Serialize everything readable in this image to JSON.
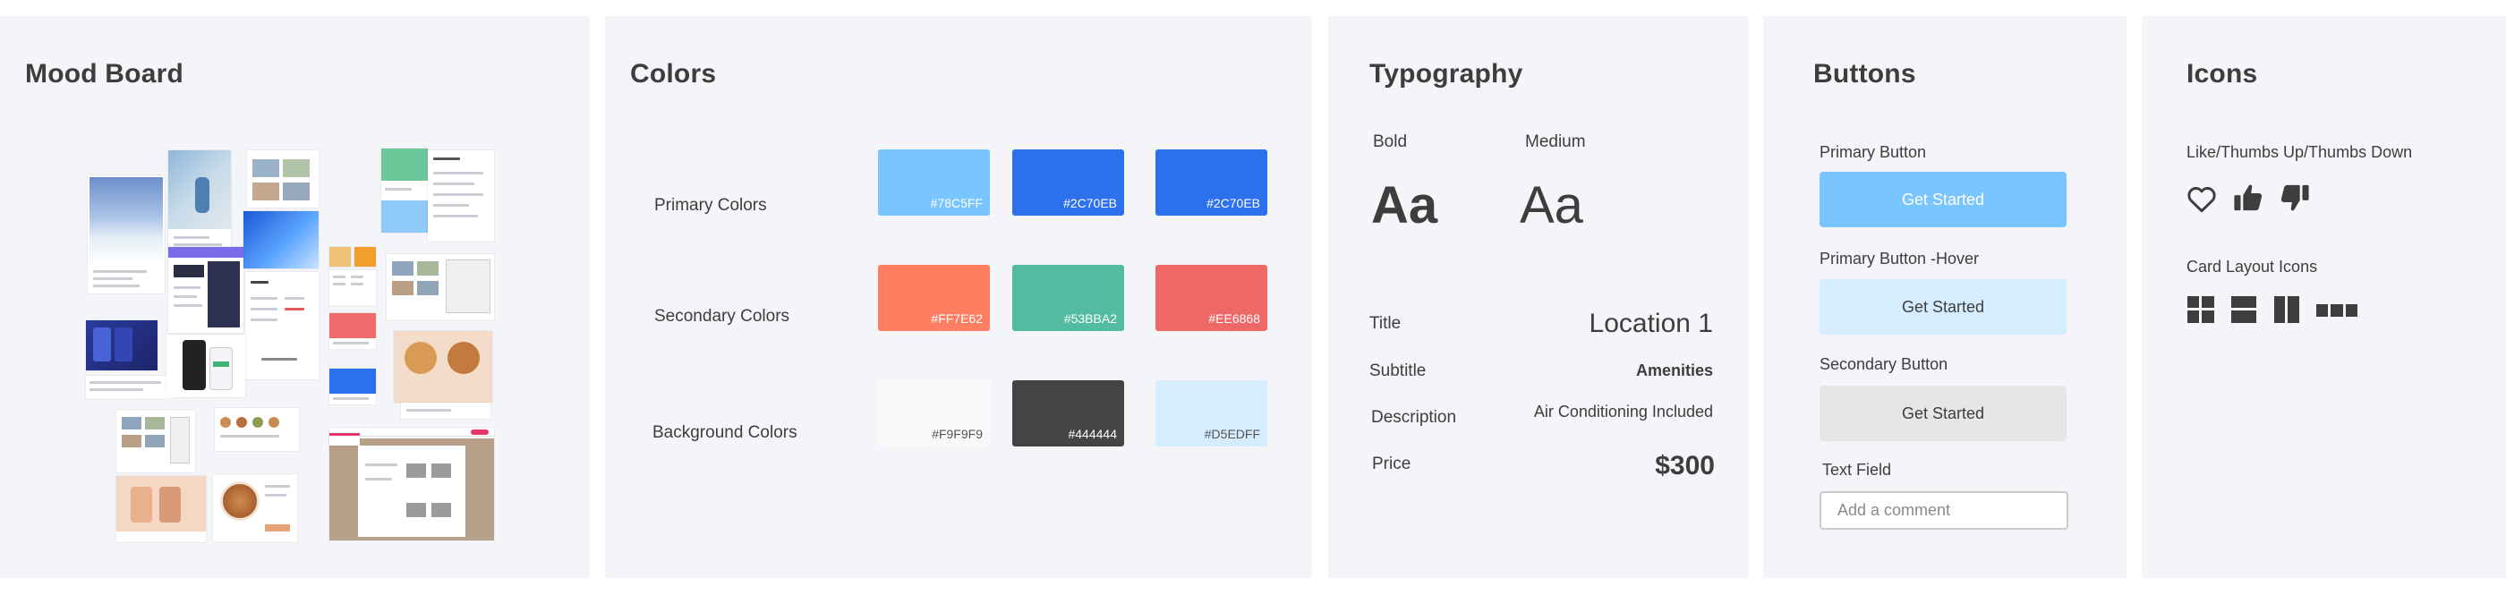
{
  "mood_board": {
    "title": "Mood Board"
  },
  "colors": {
    "title": "Colors",
    "rows": [
      {
        "label": "Primary Colors",
        "swatches": [
          {
            "hex": "#78C5FF",
            "label": "#78C5FF"
          },
          {
            "hex": "#2C70EB",
            "label": "#2C70EB"
          },
          {
            "hex": "#2C70EB",
            "label": "#2C70EB"
          }
        ]
      },
      {
        "label": "Secondary Colors",
        "swatches": [
          {
            "hex": "#FF7E62",
            "label": "#FF7E62"
          },
          {
            "hex": "#53BBA2",
            "label": "#53BBA2"
          },
          {
            "hex": "#EE6868",
            "label": "#EE6868"
          }
        ]
      },
      {
        "label": "Background Colors",
        "swatches": [
          {
            "hex": "#F9F9F9",
            "label": "#F9F9F9"
          },
          {
            "hex": "#444444",
            "label": "#444444"
          },
          {
            "hex": "#D5EDFF",
            "label": "#D5EDFF"
          }
        ]
      }
    ]
  },
  "typography": {
    "title": "Typography",
    "bold_label": "Bold",
    "medium_label": "Medium",
    "sample": "Aa",
    "specs": [
      {
        "label": "Title",
        "value": "Location 1"
      },
      {
        "label": "Subtitle",
        "value": "Amenities"
      },
      {
        "label": "Description",
        "value": "Air Conditioning Included"
      },
      {
        "label": "Price",
        "value": "$300"
      }
    ]
  },
  "buttons": {
    "title": "Buttons",
    "primary_label": "Primary Button",
    "primary_text": "Get Started",
    "primary_color": "#78C5FF",
    "hover_label": "Primary Button -Hover",
    "hover_text": "Get Started",
    "hover_color": "#D5EDFF",
    "secondary_label": "Secondary Button",
    "secondary_text": "Get Started",
    "secondary_color": "#E6E6E6",
    "text_field_label": "Text Field",
    "text_field_placeholder": "Add a comment"
  },
  "icons": {
    "title": "Icons",
    "like_label": "Like/Thumbs Up/Thumbs Down",
    "like_icons": [
      "heart-outline-icon",
      "thumbs-up-icon",
      "thumbs-down-icon"
    ],
    "layout_label": "Card Layout Icons",
    "layout_icons": [
      "grid-2x2-icon",
      "rows-2-icon",
      "columns-2-icon",
      "row-3-icon"
    ]
  }
}
